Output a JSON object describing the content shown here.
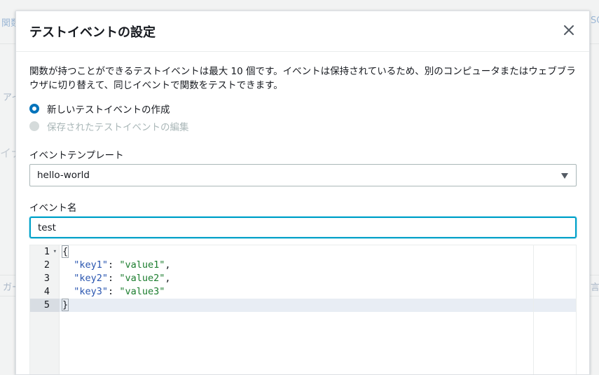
{
  "background": {
    "fragments": [
      "関数",
      "アイ",
      "イナ",
      "ガー",
      "SC",
      "言う"
    ]
  },
  "modal": {
    "title": "テストイベントの設定",
    "close_icon": "close-icon",
    "description": "関数が持つことができるテストイベントは最大 10 個です。イベントは保持されているため、別のコンピュータまたはウェブブラウザに切り替えて、同じイベントで関数をテストできます。",
    "options": [
      {
        "label": "新しいテストイベントの作成",
        "selected": true,
        "disabled": false
      },
      {
        "label": "保存されたテストイベントの編集",
        "selected": false,
        "disabled": true
      }
    ],
    "template": {
      "label": "イベントテンプレート",
      "value": "hello-world",
      "icon": "caret-down-icon"
    },
    "event_name": {
      "label": "イベント名",
      "value": "test"
    },
    "editor": {
      "lines": [
        {
          "num": "1",
          "fold": "▾",
          "braceOpen": "{"
        },
        {
          "num": "2",
          "fold": "",
          "key": "\"key1\"",
          "sep": ": ",
          "value": "\"value1\"",
          "end": ","
        },
        {
          "num": "3",
          "fold": "",
          "key": "\"key2\"",
          "sep": ": ",
          "value": "\"value2\"",
          "end": ","
        },
        {
          "num": "4",
          "fold": "",
          "key": "\"key3\"",
          "sep": ": ",
          "value": "\"value3\"",
          "end": ""
        },
        {
          "num": "5",
          "fold": "",
          "braceClose": "}"
        }
      ],
      "active_line": 5
    }
  },
  "colors": {
    "accent": "#0073bb",
    "focus": "#00a1c9",
    "json_key": "#2a56b0",
    "json_string": "#1b7d2e"
  }
}
